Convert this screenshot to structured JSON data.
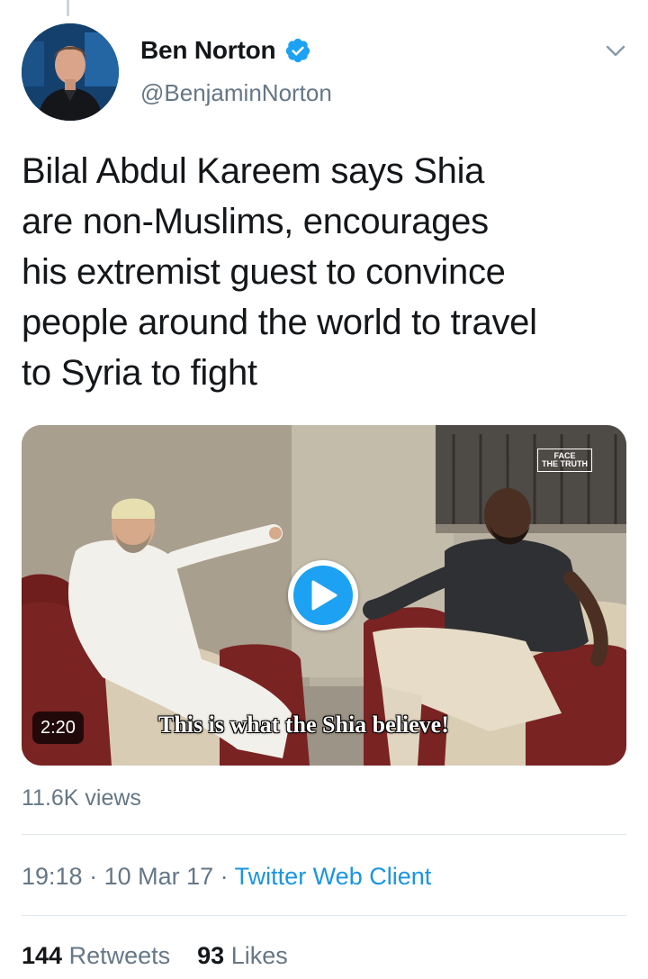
{
  "tweet": {
    "author": {
      "name": "Ben Norton",
      "handle": "@BenjaminNorton",
      "verified": true
    },
    "text": "Bilal Abdul Kareem says Shia\nare non-Muslims, encourages\nhis extremist guest to convince\npeople around the world to travel\nto Syria to fight",
    "media": {
      "type": "video",
      "duration": "2:20",
      "subtitle": "This is what the Shia believe!",
      "watermark_line1": "FACE",
      "watermark_line2": "THE TRUTH"
    },
    "views": "11.6K views",
    "time": "19:18",
    "date": "10 Mar 17",
    "separator": " · ",
    "source": "Twitter Web Client",
    "stats": {
      "retweets_count": "144",
      "retweets_label": "Retweets",
      "likes_count": "93",
      "likes_label": "Likes"
    }
  },
  "colors": {
    "accent": "#1da1f2",
    "link": "#1b95e0",
    "secondary_text": "#657786",
    "primary_text": "#14171a",
    "divider": "#e1e8ed"
  },
  "icons": {
    "verified": "verified-badge-icon",
    "more": "chevron-down-icon",
    "play": "play-icon"
  }
}
